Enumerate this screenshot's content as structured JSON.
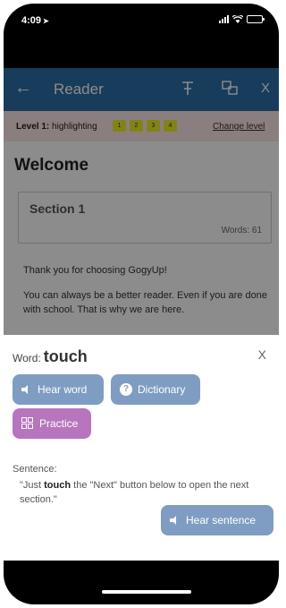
{
  "status": {
    "time": "4:09"
  },
  "appbar": {
    "title": "Reader",
    "back_icon": "arrow-left-icon",
    "icons": [
      "text-size-icon",
      "translate-icon",
      "close-icon"
    ],
    "close_glyph": "X"
  },
  "level": {
    "label": "Level 1:",
    "mode": "highlighting",
    "chips": [
      "1",
      "2",
      "3",
      "4"
    ],
    "change_label": "Change level"
  },
  "content": {
    "heading": "Welcome",
    "section_title": "Section 1",
    "words_label": "Words: 61",
    "paragraph1": "Thank you for choosing GogyUp!",
    "paragraph2": "You can always be a better reader. Even if you are done with school. That is why we are here."
  },
  "sheet": {
    "word_label": "Word:",
    "word": "touch",
    "close_glyph": "X",
    "buttons": {
      "hear_word": "Hear word",
      "dictionary": "Dictionary",
      "practice": "Practice",
      "hear_sentence": "Hear sentence"
    },
    "sentence_label": "Sentence:",
    "sentence_pre": "\"Just ",
    "sentence_word": "touch",
    "sentence_post": " the \"Next\" button below to open the next section.\""
  },
  "colors": {
    "appbar": "#2d6da6",
    "level_bg": "#fbe7e5",
    "chip": "#ecef2a",
    "button_blue": "#7f9dc2",
    "button_purple": "#b775bd"
  }
}
